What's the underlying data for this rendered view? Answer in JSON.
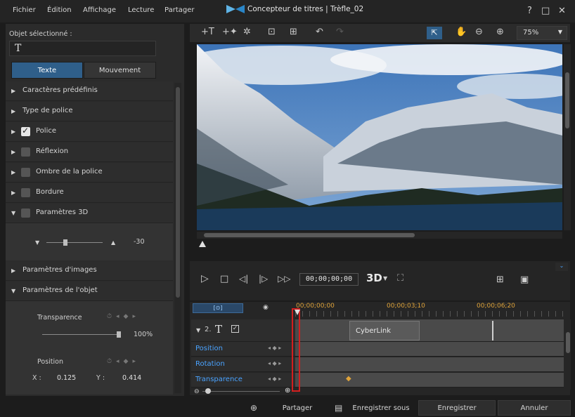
{
  "menu": {
    "items": [
      "Fichier",
      "Édition",
      "Affichage",
      "Lecture",
      "Partager"
    ]
  },
  "window": {
    "title": "Concepteur de titres  |  Trèfle_02",
    "controls": [
      "?",
      "□",
      "✕"
    ]
  },
  "left_panel": {
    "selected_label": "Objet sélectionné :",
    "selected_value": "T",
    "tabs": [
      "Texte",
      "Mouvement"
    ],
    "sections": [
      {
        "label": "Caractères prédéfinis",
        "checkbox": false,
        "checked": false,
        "expanded": false
      },
      {
        "label": "Type de police",
        "checkbox": false,
        "checked": false,
        "expanded": false
      },
      {
        "label": "Police",
        "checkbox": true,
        "checked": true,
        "expanded": false
      },
      {
        "label": "Réflexion",
        "checkbox": true,
        "checked": false,
        "expanded": false
      },
      {
        "label": "Ombre de la police",
        "checkbox": true,
        "checked": false,
        "expanded": false
      },
      {
        "label": "Bordure",
        "checkbox": true,
        "checked": false,
        "expanded": false
      },
      {
        "label": "Paramètres 3D",
        "checkbox": true,
        "checked": false,
        "expanded": true
      }
    ],
    "settings_3d_value": "-30",
    "sections_after": [
      {
        "label": "Paramètres d'images",
        "expanded": false
      },
      {
        "label": "Paramètres de l'objet",
        "expanded": true
      }
    ],
    "object_params": {
      "transparency_label": "Transparence",
      "transparency_value": "100%",
      "position_label": "Position",
      "x_label": "X :",
      "x_value": "0.125",
      "y_label": "Y :",
      "y_value": "0.414"
    }
  },
  "preview": {
    "zoom": "75%"
  },
  "player": {
    "timecode": "00;00;00;00",
    "mode_3d": "3D"
  },
  "timeline": {
    "ruler": [
      "00;00;00;00",
      "00;00;03;10",
      "00;00;06;20"
    ],
    "track_number": "2.",
    "track_icon": "T",
    "clip_label": "CyberLink",
    "rows": [
      "Position",
      "Rotation",
      "Transparence"
    ]
  },
  "bottom": {
    "buttons": [
      "Partager",
      "Enregistrer sous",
      "Enregistrer",
      "Annuler"
    ]
  },
  "colors": {
    "accent": "#2f5f8a",
    "keyframe": "#e0a43a",
    "playhead": "#d21f1f",
    "link": "#4aa3ff"
  }
}
